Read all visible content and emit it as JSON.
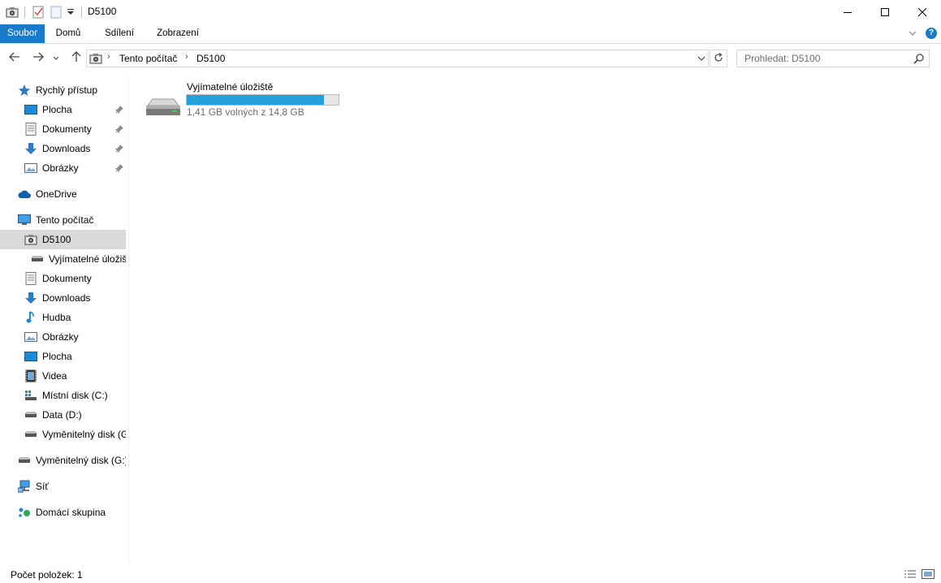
{
  "window": {
    "title": "D5100",
    "controls": {
      "minimize_icon": "minimize-icon",
      "maximize_icon": "maximize-icon",
      "close_icon": "close-icon"
    }
  },
  "ribbon": {
    "tabs": [
      {
        "label": "Soubor"
      },
      {
        "label": "Domů"
      },
      {
        "label": "Sdílení"
      },
      {
        "label": "Zobrazení"
      }
    ],
    "help_label": "?"
  },
  "address": {
    "breadcrumbs": [
      "Tento počítač",
      "D5100"
    ]
  },
  "search": {
    "placeholder": "Prohledat: D5100"
  },
  "sidebar": {
    "items": [
      {
        "label": "Rychlý přístup",
        "icon": "star-icon"
      },
      {
        "label": "Plocha",
        "icon": "desktop-icon",
        "pinned": true
      },
      {
        "label": "Dokumenty",
        "icon": "document-icon",
        "pinned": true
      },
      {
        "label": "Downloads",
        "icon": "download-icon",
        "pinned": true
      },
      {
        "label": "Obrázky",
        "icon": "pictures-icon",
        "pinned": true
      },
      {
        "label": "OneDrive",
        "icon": "cloud-icon"
      },
      {
        "label": "Tento počítač",
        "icon": "computer-icon"
      },
      {
        "label": "D5100",
        "icon": "camera-icon",
        "selected": true
      },
      {
        "label": "Vyjímatelné úložiště",
        "icon": "drive-icon"
      },
      {
        "label": "Dokumenty",
        "icon": "document-icon"
      },
      {
        "label": "Downloads",
        "icon": "download-icon"
      },
      {
        "label": "Hudba",
        "icon": "music-icon"
      },
      {
        "label": "Obrázky",
        "icon": "pictures-icon"
      },
      {
        "label": "Plocha",
        "icon": "desktop-icon"
      },
      {
        "label": "Videa",
        "icon": "video-icon"
      },
      {
        "label": "Místní disk (C:)",
        "icon": "windows-drive-icon"
      },
      {
        "label": "Data (D:)",
        "icon": "drive-icon"
      },
      {
        "label": "Vyměnitelný disk (G:)",
        "icon": "drive-icon"
      },
      {
        "label": "Vyměnitelný disk (G:)",
        "icon": "drive-icon"
      },
      {
        "label": "Síť",
        "icon": "network-icon"
      },
      {
        "label": "Domácí skupina",
        "icon": "homegroup-icon"
      }
    ]
  },
  "main": {
    "drive": {
      "name": "Vyjímatelné úložiště",
      "free_text": "1,41 GB volných z 14,8 GB",
      "used_fraction": 0.905
    }
  },
  "statusbar": {
    "text": "Počet položek: 1"
  },
  "colors": {
    "accent": "#1979ca",
    "progress": "#26a0da",
    "selected_bg": "#d9d9d9"
  }
}
